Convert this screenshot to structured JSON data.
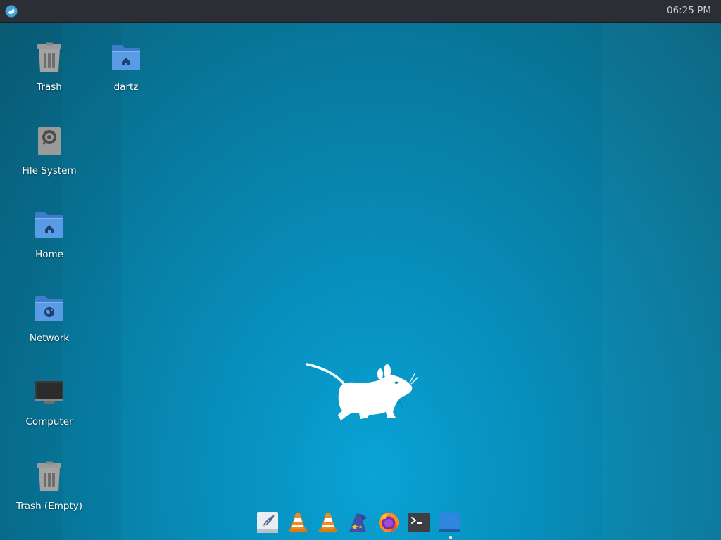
{
  "panel": {
    "menu_icon": "xfce-whisker-menu-icon",
    "clock": "06:25 PM"
  },
  "desktop": {
    "icons": [
      {
        "label": "Trash",
        "icon": "trash-icon"
      },
      {
        "label": "dartz",
        "icon": "home-folder-icon"
      },
      {
        "label": "File System",
        "icon": "drive-icon"
      },
      {
        "label": "Home",
        "icon": "home-folder-icon"
      },
      {
        "label": "Network",
        "icon": "network-folder-icon"
      },
      {
        "label": "Computer",
        "icon": "computer-monitor-icon"
      },
      {
        "label": "Trash (Empty)",
        "icon": "trash-icon"
      }
    ]
  },
  "dock": {
    "items": [
      {
        "name": "text-editor",
        "icon": "feather-quill-icon"
      },
      {
        "name": "vlc",
        "icon": "traffic-cone-icon"
      },
      {
        "name": "vlc",
        "icon": "traffic-cone-icon"
      },
      {
        "name": "app-wizard",
        "icon": "wizard-hat-icon"
      },
      {
        "name": "firefox",
        "icon": "firefox-icon"
      },
      {
        "name": "terminal",
        "icon": "terminal-icon"
      },
      {
        "name": "window",
        "icon": "window-icon"
      }
    ]
  },
  "colors": {
    "panel_bg": "#2b2e35",
    "desktop_bg": "#0792c0",
    "folder_blue": "#4a90e2",
    "icon_text": "#ffffff",
    "clock_text": "#c8cbd0"
  }
}
